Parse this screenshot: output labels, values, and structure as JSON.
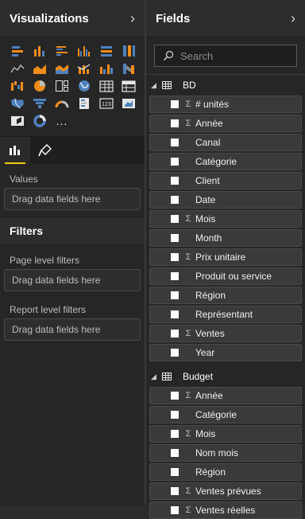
{
  "visualizations": {
    "title": "Visualizations",
    "icons": [
      "stacked-bar-icon",
      "stacked-column-icon",
      "clustered-bar-icon",
      "clustered-column-icon",
      "100-stacked-bar-icon",
      "100-stacked-column-icon",
      "line-chart-icon",
      "area-chart-icon",
      "stacked-area-icon",
      "line-column-icon",
      "line-clustered-column-icon",
      "ribbon-chart-icon",
      "waterfall-icon",
      "pie-chart-icon",
      "treemap-icon",
      "globe-map-icon",
      "table-visual-icon",
      "matrix-icon",
      "filled-map-icon",
      "funnel-icon",
      "gauge-icon",
      "multi-row-card-icon",
      "card-icon",
      "kpi-icon",
      "slicer-icon",
      "donut-chart-icon"
    ],
    "more_label": "...",
    "tabs": [
      "fields-tab",
      "format-tab"
    ],
    "values_label": "Values",
    "dropzone_text": "Drag data fields here"
  },
  "filters": {
    "title": "Filters",
    "page_label": "Page level filters",
    "page_drop": "Drag data fields here",
    "report_label": "Report level filters",
    "report_drop": "Drag data fields here"
  },
  "fields": {
    "title": "Fields",
    "search_placeholder": "Search",
    "tables": [
      {
        "name": "BD",
        "fields": [
          {
            "label": "# unités",
            "sigma": true
          },
          {
            "label": "Année",
            "sigma": true
          },
          {
            "label": "Canal",
            "sigma": false
          },
          {
            "label": "Catégorie",
            "sigma": false
          },
          {
            "label": "Client",
            "sigma": false
          },
          {
            "label": "Date",
            "sigma": false
          },
          {
            "label": "Mois",
            "sigma": true
          },
          {
            "label": "Month",
            "sigma": false
          },
          {
            "label": "Prix unitaire",
            "sigma": true
          },
          {
            "label": "Produit ou service",
            "sigma": false
          },
          {
            "label": "Région",
            "sigma": false
          },
          {
            "label": "Représentant",
            "sigma": false
          },
          {
            "label": "Ventes",
            "sigma": true
          },
          {
            "label": "Year",
            "sigma": false
          }
        ]
      },
      {
        "name": "Budget",
        "fields": [
          {
            "label": "Année",
            "sigma": true
          },
          {
            "label": "Catégorie",
            "sigma": false
          },
          {
            "label": "Mois",
            "sigma": true
          },
          {
            "label": "Nom mois",
            "sigma": false
          },
          {
            "label": "Région",
            "sigma": false
          },
          {
            "label": "Ventes prévues",
            "sigma": true
          },
          {
            "label": "Ventes réelles",
            "sigma": true
          }
        ]
      }
    ],
    "sigma_symbol": "Σ"
  },
  "colors": {
    "accent": "#f2c811",
    "orange": "#f08c1a",
    "blue": "#4f81bd",
    "panel": "#262626"
  }
}
